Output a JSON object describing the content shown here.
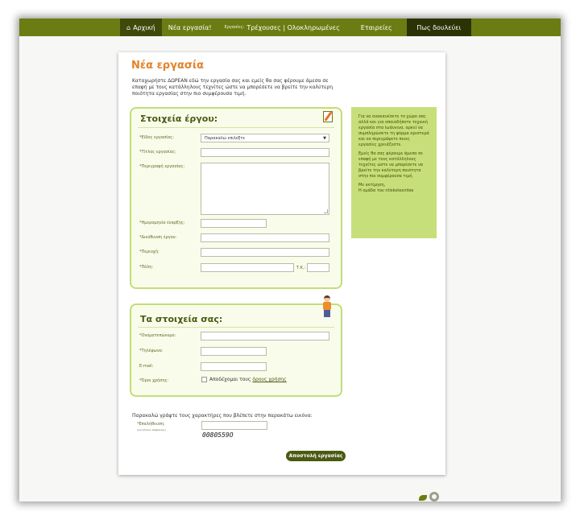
{
  "nav": {
    "home": "Αρχική",
    "new_job": "Νέα εργασία!",
    "jobs_prefix": "Εργασίες:",
    "jobs_links": "Τρέχουσες | Ολοκληρωμένες",
    "companies": "Εταιρείες",
    "how_it_works": "Πως δουλεύει"
  },
  "page": {
    "title": "Νέα εργασία",
    "intro": "Καταχωρήστε ΔΩΡΕΑΝ εδώ την εργασία σας και εμείς θα σας φέρουμε άμεσα σε επαφή με τους κατάλληλους τεχνίτες ώστε να μπορέσετε να βρείτε την καλύτερη ποιότητα εργασίας στην πιο συμφέρουσα τιμή."
  },
  "job_section": {
    "title": "Στοιχεία έργου:",
    "fields": {
      "type_label": "*Είδος εργασίας:",
      "type_value": "Παρακαλώ επιλέξτε",
      "title_label": "*Τίτλος εργασίας:",
      "description_label": "*Περιγραφή εργασίας:",
      "start_date_label": "*Ημερομηνία έναρξης:",
      "address_label": "*Διεύθυνση έργου:",
      "area_label": "*Περιοχή:",
      "city_label": "*Πόλη:",
      "postcode_label": "Τ.Κ.:"
    }
  },
  "personal_section": {
    "title": "Τα στοιχεία σας:",
    "fields": {
      "name_label": "*Ονοματεπώνυμο:",
      "phone_label": "*Τηλέφωνο:",
      "email_label": "E-mail:",
      "terms_label": "*Όροι χρήσης:",
      "terms_text": "Αποδέχομαι τους",
      "terms_link": "όρους χρήσης"
    }
  },
  "side_box": {
    "p1": "Για να ανακαινίσετε το χώρο σας αλλά και για οποιαδήποτε τεχνική εργασία στα Ιωάννινα, αρκεί να συμπληρώσετε τη φόρμα αριστερά και να περιγράψετε ποιες εργασίες χρειάζεστε.",
    "p2": "Εμείς θα σας φέρουμε άμεσα σε επαφή με τους κατάλληλους τεχνίτες ώστε να μπορέσετε να βρείτε την καλύτερη ποιότητα στην πιο συμφέρουσα τιμή.",
    "p3": "Με εκτίμηση,",
    "p4": "Η ομάδα του ntiskotexnites"
  },
  "captcha": {
    "instructions": "Παρακαλώ γράψτε τους χαρακτήρες που βλέπετε στην παρακάτω εικόνα:",
    "label": "*Επαλήθευση:",
    "hint": "(για λόγους ασφαλείας)",
    "code": "0080559O"
  },
  "submit_label": "Αποστολή εργασίας",
  "colors": {
    "nav_bg": "#6b7d12",
    "title_orange": "#e4822a",
    "box_border": "#c2dd79",
    "side_box_bg": "#c7df7a",
    "button_bg": "#4a5a12"
  }
}
